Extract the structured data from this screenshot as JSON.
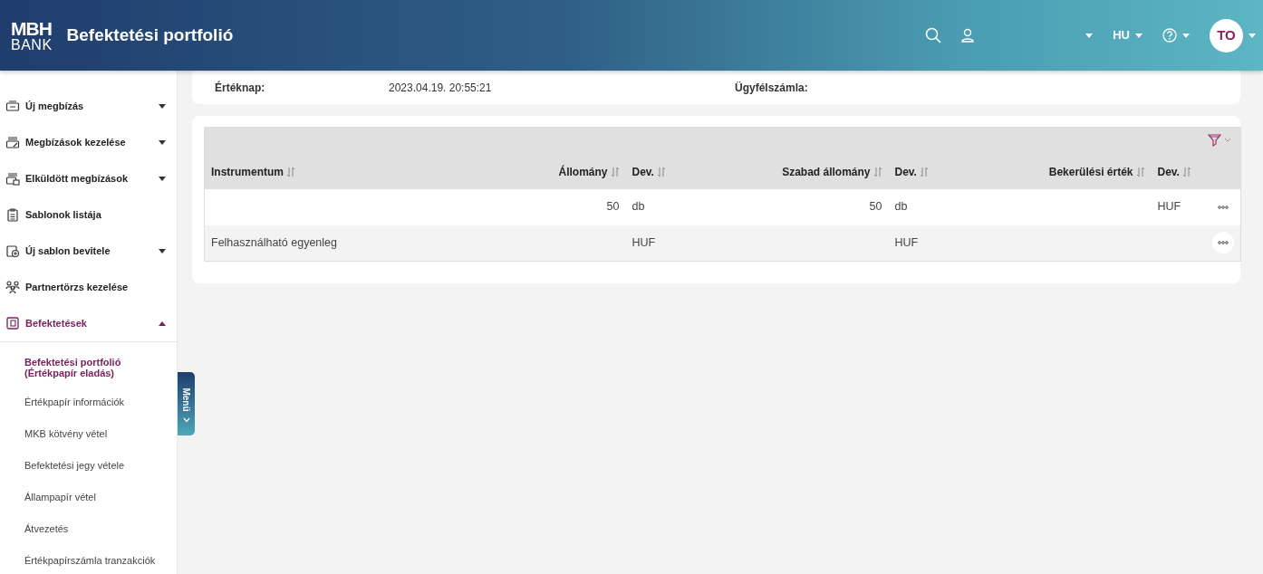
{
  "header": {
    "logo": {
      "line1": "MBH",
      "line2": "BANK"
    },
    "title": "Befektetési portfolió",
    "language": "HU",
    "avatar": "TO"
  },
  "sidebar": {
    "items": [
      {
        "label": "Új megbízás",
        "kind": "group",
        "expanded": false,
        "selected": false
      },
      {
        "label": "Megbízások kezelése",
        "kind": "group",
        "expanded": false,
        "selected": false
      },
      {
        "label": "Elküldött megbízások",
        "kind": "group",
        "expanded": false,
        "selected": false
      },
      {
        "label": "Sablonok listája",
        "kind": "link",
        "selected": false
      },
      {
        "label": "Új sablon bevitele",
        "kind": "group",
        "expanded": false,
        "selected": false
      },
      {
        "label": "Partnertörzs kezelése",
        "kind": "link",
        "selected": false
      },
      {
        "label": "Befektetések",
        "kind": "group",
        "expanded": true,
        "selected": true,
        "children": [
          {
            "label": "Befektetési portfolió (Értékpapír eladás)",
            "selected": true
          },
          {
            "label": "Értékpapír információk",
            "selected": false
          },
          {
            "label": "MKB kötvény vétel",
            "selected": false
          },
          {
            "label": "Befektetési jegy vétele",
            "selected": false
          },
          {
            "label": "Állampapír vétel",
            "selected": false
          },
          {
            "label": "Átvezetés",
            "selected": false
          },
          {
            "label": "Értékpapírszámla tranzakciók",
            "selected": false
          }
        ]
      }
    ],
    "toggle": "Menü"
  },
  "summary": {
    "value_date_label": "Értéknap:",
    "value_date": "2023.04.19. 20:55:21",
    "account_label": "Ügyfélszámla:"
  },
  "table": {
    "columns": [
      {
        "label": "Instrumentum",
        "numeric": false
      },
      {
        "label": "Állomány",
        "numeric": true
      },
      {
        "label": "Dev.",
        "numeric": false
      },
      {
        "label": "Szabad állomány",
        "numeric": true
      },
      {
        "label": "Dev.",
        "numeric": false
      },
      {
        "label": "Bekerülési érték",
        "numeric": true
      },
      {
        "label": "Dev.",
        "numeric": false
      }
    ],
    "rows": [
      [
        "",
        "50",
        "db",
        "50",
        "db",
        "",
        "HUF"
      ],
      [
        "Felhasználható egyenleg",
        "",
        "HUF",
        "",
        "HUF",
        "",
        ""
      ]
    ]
  }
}
